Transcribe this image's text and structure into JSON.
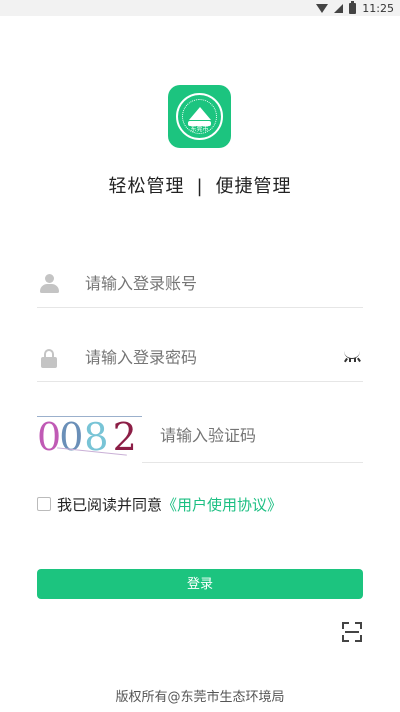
{
  "status_bar": {
    "time": "11:25",
    "icons": [
      "wifi-icon",
      "signal-icon",
      "battery-icon"
    ]
  },
  "app": {
    "logo_icon": "environment-seal-icon",
    "logo_text": "东莞市",
    "slogan_left": "轻松管理",
    "slogan_separator": "|",
    "slogan_right": "便捷管理",
    "accent_color": "#1cc47f"
  },
  "form": {
    "username": {
      "placeholder": "请输入登录账号",
      "icon": "user-icon",
      "value": ""
    },
    "password": {
      "placeholder": "请输入登录密码",
      "icon": "lock-icon",
      "toggle_icon": "eye-closed-icon",
      "value": ""
    },
    "captcha": {
      "image_text": "0082",
      "placeholder": "请输入验证码",
      "value": ""
    },
    "agreement": {
      "checked": false,
      "prefix": "我已阅读并同意",
      "link": "《用户使用协议》"
    },
    "login_label": "登录",
    "scan_icon": "scan-icon"
  },
  "footer": {
    "copyright": "版权所有@东莞市生态环境局"
  }
}
